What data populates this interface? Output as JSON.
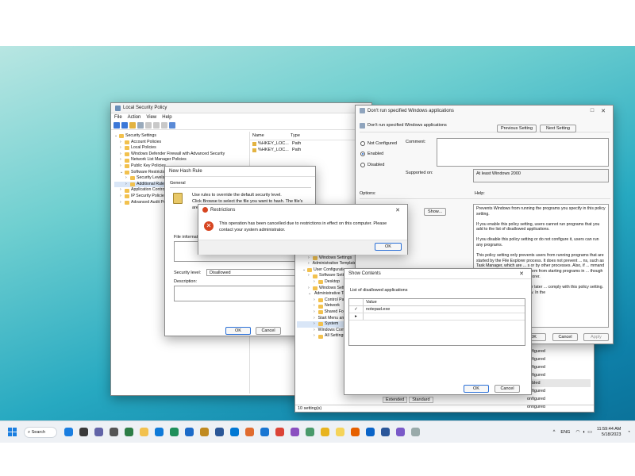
{
  "lsp": {
    "title": "Local Security Policy",
    "menu": [
      "File",
      "Action",
      "View",
      "Help"
    ],
    "tree": [
      {
        "label": "Security Settings",
        "level": 0,
        "open": true
      },
      {
        "label": "Account Policies",
        "level": 1
      },
      {
        "label": "Local Policies",
        "level": 1
      },
      {
        "label": "Windows Defender Firewall with Advanced Security",
        "level": 1
      },
      {
        "label": "Network List Manager Policies",
        "level": 1
      },
      {
        "label": "Public Key Policies",
        "level": 1
      },
      {
        "label": "Software Restriction Policies",
        "level": 1,
        "open": true
      },
      {
        "label": "Security Levels",
        "level": 2
      },
      {
        "label": "Additional Rules",
        "level": 2,
        "selected": true
      },
      {
        "label": "Application Control Policies",
        "level": 1
      },
      {
        "label": "IP Security Policies",
        "level": 1
      },
      {
        "label": "Advanced Audit Policies",
        "level": 1
      }
    ],
    "columns": [
      "Name",
      "Type"
    ],
    "rows": [
      {
        "name": "%HKEY_LOC...",
        "type": "Path"
      },
      {
        "name": "%HKEY_LOC...",
        "type": "Path"
      }
    ]
  },
  "hash": {
    "title": "New Hash Rule",
    "tab": "General",
    "desc1": "Use rules to override the default security level.",
    "desc2": "Click Browse to select the file you want to hash. The file's",
    "desc3": "are",
    "file_info_label": "File information",
    "security_label": "Security level:",
    "security_value": "Disallowed",
    "description_label": "Description:",
    "ok": "OK",
    "cancel": "Cancel"
  },
  "gpo": {
    "title": "Don't run specified Windows applications",
    "subtitle": "Don't run specified Windows applications",
    "prev": "Previous Setting",
    "next": "Next Setting",
    "not_configured": "Not Configured",
    "enabled": "Enabled",
    "disabled": "Disabled",
    "selected": "Enabled",
    "comment": "Comment:",
    "supported_label": "Supported on:",
    "supported_value": "At least Windows 2000",
    "options": "Options:",
    "help": "Help:",
    "show": "Show...",
    "help_text": [
      "Prevents Windows from running the programs you specify in this policy setting.",
      "If you enable this policy setting, users cannot run programs that you add to the list of disallowed applications.",
      "If you disable this policy setting or do not configure it, users can run any programs.",
      "This policy setting only prevents users from running programs that are started by the File Explorer process. It does not prevent ... ns, such as Task Manager, which are ... s or by other processes. Also, if ... mmand prompt (Cmd.exe), this ... nt them from starting programs in ... though they would be prevented ... xplorer.",
      "... ations with Windows 2000 or later ... comply with this policy setting. ... wed applications, click Show. In the"
    ],
    "ok": "OK",
    "cancel": "Cancel",
    "apply": "Apply"
  },
  "gpedit": {
    "tree": [
      {
        "label": "Software Settings",
        "level": 2
      },
      {
        "label": "Windows Settings",
        "level": 2
      },
      {
        "label": "Administrative Templates",
        "level": 2
      },
      {
        "label": "User Configuration",
        "level": 1,
        "open": true
      },
      {
        "label": "Software Settings",
        "level": 2
      },
      {
        "label": "Desktop",
        "level": 3
      },
      {
        "label": "Windows Settings",
        "level": 2
      },
      {
        "label": "Administrative Templates",
        "level": 2,
        "open": true
      },
      {
        "label": "Control Panel",
        "level": 3
      },
      {
        "label": "Network",
        "level": 3
      },
      {
        "label": "Shared Folders",
        "level": 3
      },
      {
        "label": "Start Menu and Taskbar",
        "level": 3
      },
      {
        "label": "System",
        "level": 3,
        "selected": true
      },
      {
        "label": "Windows Components",
        "level": 3
      },
      {
        "label": "All Settings",
        "level": 3
      }
    ],
    "state_col": [
      "onfigured",
      "onfigured",
      "onfigured",
      "onfigured",
      "nabled",
      "onfigured",
      "onfigured",
      "onfigured"
    ],
    "tabs": [
      "Extended",
      "Standard"
    ],
    "status": "10 setting(s)"
  },
  "show": {
    "title": "Show Contents",
    "caption": "List of disallowed applications",
    "column": "Value",
    "values": [
      "notepad.exe"
    ],
    "ok": "OK",
    "cancel": "Cancel"
  },
  "restrictions": {
    "title": "Restrictions",
    "message": "This operation has been cancelled due to restrictions in effect on this computer. Please contact your system administrator.",
    "ok": "OK"
  },
  "taskbar": {
    "search": "Search",
    "lang": "ENG",
    "time": "11:59:44 AM",
    "date": "5/18/2023",
    "apps": [
      "start-icon",
      "search-icon",
      "widgets-icon",
      "teams-icon",
      "settings-icon",
      "terminal-icon",
      "file-explorer-icon",
      "edge-icon",
      "edge-beta-icon",
      "edge-dev-icon",
      "edge-canary-icon",
      "store-icon",
      "code-icon",
      "photos-icon",
      "calendar-icon",
      "chrome-icon",
      "paint-icon",
      "notepad-icon",
      "snipping-icon",
      "sticky-notes-icon",
      "firefox-icon",
      "outlook-icon",
      "word-icon",
      "notes-icon",
      "document-icon",
      "office-icon"
    ],
    "colors": {
      "accent": "#1a5fc8",
      "error": "#d64520"
    }
  }
}
